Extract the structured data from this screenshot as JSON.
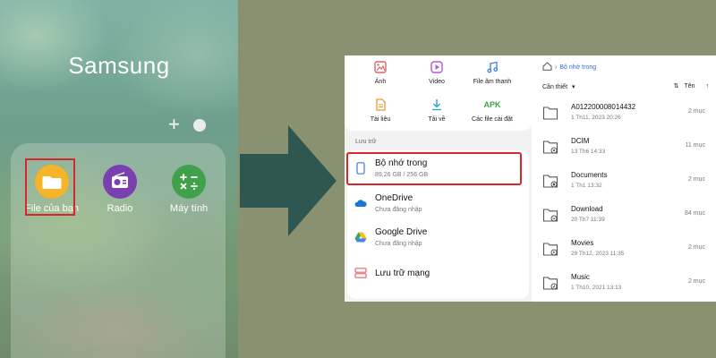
{
  "launcher": {
    "folder_title": "Samsung",
    "apps": [
      {
        "label": "File của bạn",
        "color": "#f4b528"
      },
      {
        "label": "Radio",
        "color": "#7a3fb0"
      },
      {
        "label": "Máy tính",
        "color": "#3fa14a"
      }
    ]
  },
  "files_home": {
    "categories": [
      {
        "label": "Ảnh",
        "icon": "image-icon"
      },
      {
        "label": "Video",
        "icon": "video-icon"
      },
      {
        "label": "File âm thanh",
        "icon": "music-icon"
      },
      {
        "label": "Tài liệu",
        "icon": "document-icon"
      },
      {
        "label": "Tải về",
        "icon": "download-icon"
      },
      {
        "label": "Các file cài đặt",
        "icon": "apk-icon",
        "icon_text": "APK"
      }
    ],
    "storage_section_label": "Lưu trữ",
    "storage": [
      {
        "title": "Bộ nhớ trong",
        "subtitle": "89,26 GB / 256 GB",
        "icon": "phone-icon"
      },
      {
        "title": "OneDrive",
        "subtitle": "Chưa đăng nhập",
        "icon": "onedrive-icon"
      },
      {
        "title": "Google Drive",
        "subtitle": "Chưa đăng nhập",
        "icon": "google-drive-icon"
      },
      {
        "title": "Lưu trữ mạng",
        "subtitle": "",
        "icon": "network-storage-icon"
      }
    ]
  },
  "internal_storage": {
    "breadcrumb": "Bộ nhớ trong",
    "sort_label": "Cần thiết",
    "sort_by": "Tên",
    "folders": [
      {
        "name": "A012200008014432",
        "date": "1 Th11, 2023 20:26",
        "count": "2 mục",
        "badge": "none"
      },
      {
        "name": "DCIM",
        "date": "13 Th6 14:33",
        "count": "11 mục",
        "badge": "camera"
      },
      {
        "name": "Documents",
        "date": "1 Th1 13:32",
        "count": "2 mục",
        "badge": "document"
      },
      {
        "name": "Download",
        "date": "20 Th7 11:39",
        "count": "84 mục",
        "badge": "download"
      },
      {
        "name": "Movies",
        "date": "29 Th12, 2023 11:35",
        "count": "2 mục",
        "badge": "play"
      },
      {
        "name": "Music",
        "date": "1 Th10, 2021 13:13",
        "count": "2 mục",
        "badge": "music"
      }
    ]
  },
  "colors": {
    "highlight": "#d8262a",
    "accent_blue": "#2f6ad6",
    "background": "#8a9171",
    "arrow": "#2f5751"
  }
}
